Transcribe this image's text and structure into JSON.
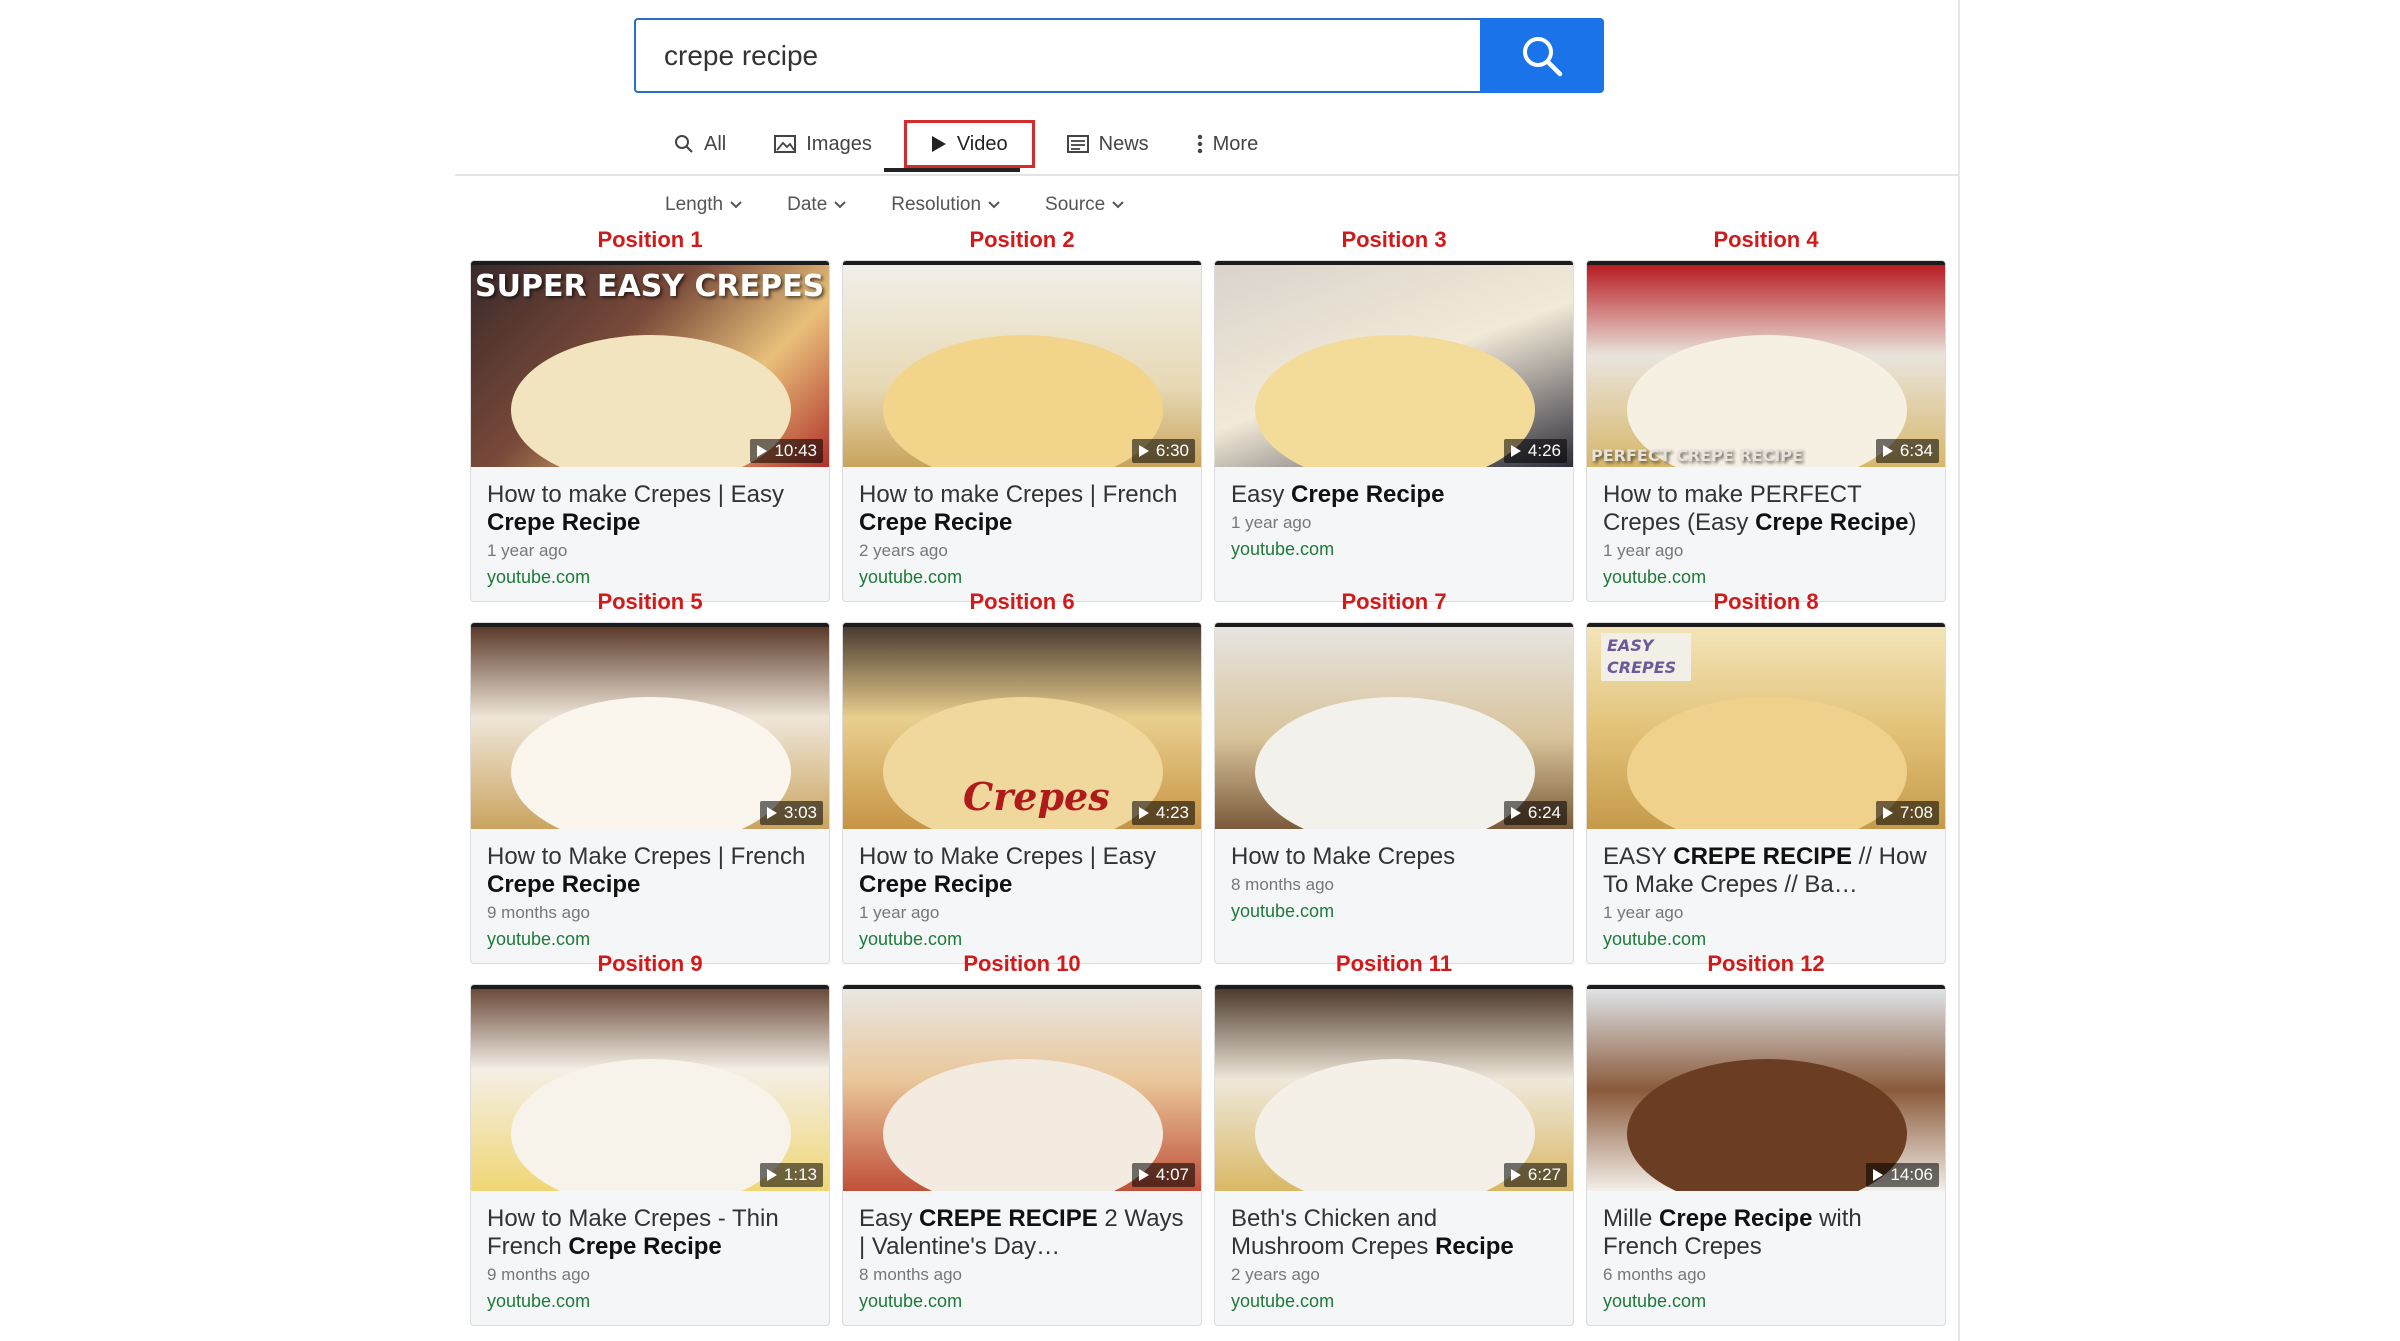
{
  "search": {
    "query": "crepe recipe"
  },
  "tabs": [
    {
      "label": "All",
      "icon": "search-icon"
    },
    {
      "label": "Images",
      "icon": "image-icon"
    },
    {
      "label": "Video",
      "icon": "play-icon",
      "active": true
    },
    {
      "label": "News",
      "icon": "news-icon"
    },
    {
      "label": "More",
      "icon": "more-vertical-icon"
    }
  ],
  "filters": [
    "Length",
    "Date",
    "Resolution",
    "Source"
  ],
  "colors": {
    "accent": "#1a73e8",
    "highlight_red": "#d11a1a",
    "source_green": "#1e7a3a"
  },
  "results": [
    {
      "position": "Position 1",
      "duration": "10:43",
      "title_parts": [
        [
          "How to make Crepes | Easy ",
          false
        ],
        [
          "Crepe Recipe",
          true
        ]
      ],
      "age": "1 year ago",
      "source": "youtube.com",
      "overlay": "SUPER EASY CREPES"
    },
    {
      "position": "Position 2",
      "duration": "6:30",
      "title_parts": [
        [
          "How to make Crepes | French ",
          false
        ],
        [
          "Crepe Recipe",
          true
        ]
      ],
      "age": "2 years ago",
      "source": "youtube.com"
    },
    {
      "position": "Position 3",
      "duration": "4:26",
      "title_parts": [
        [
          "Easy ",
          false
        ],
        [
          "Crepe Recipe",
          true
        ]
      ],
      "age": "1 year ago",
      "source": "youtube.com"
    },
    {
      "position": "Position 4",
      "duration": "6:34",
      "title_parts": [
        [
          "How to make PERFECT Crepes (Easy ",
          false
        ],
        [
          "Crepe Recipe",
          true
        ],
        [
          ")",
          false
        ]
      ],
      "age": "1 year ago",
      "source": "youtube.com",
      "overlay": "PERFECT CREPE RECIPE"
    },
    {
      "position": "Position 5",
      "duration": "3:03",
      "title_parts": [
        [
          "How to Make Crepes | French ",
          false
        ],
        [
          "Crepe Recipe",
          true
        ]
      ],
      "age": "9 months ago",
      "source": "youtube.com"
    },
    {
      "position": "Position 6",
      "duration": "4:23",
      "title_parts": [
        [
          "How to Make Crepes | Easy ",
          false
        ],
        [
          "Crepe Recipe",
          true
        ]
      ],
      "age": "1 year ago",
      "source": "youtube.com",
      "overlay": "Crepes"
    },
    {
      "position": "Position 7",
      "duration": "6:24",
      "title_parts": [
        [
          "How to Make Crepes",
          false
        ]
      ],
      "age": "8 months ago",
      "source": "youtube.com"
    },
    {
      "position": "Position 8",
      "duration": "7:08",
      "title_parts": [
        [
          "EASY ",
          false
        ],
        [
          "CREPE RECIPE",
          true
        ],
        [
          " // How To Make Crepes // Ba…",
          false
        ]
      ],
      "age": "1 year ago",
      "source": "youtube.com",
      "overlay": "EASY CREPES"
    },
    {
      "position": "Position 9",
      "duration": "1:13",
      "title_parts": [
        [
          "How to Make Crepes - Thin French ",
          false
        ],
        [
          "Crepe Recipe",
          true
        ]
      ],
      "age": "9 months ago",
      "source": "youtube.com"
    },
    {
      "position": "Position 10",
      "duration": "4:07",
      "title_parts": [
        [
          "Easy ",
          false
        ],
        [
          "CREPE RECIPE",
          true
        ],
        [
          " 2 Ways | Valentine's Day…",
          false
        ]
      ],
      "age": "8 months ago",
      "source": "youtube.com"
    },
    {
      "position": "Position 11",
      "duration": "6:27",
      "title_parts": [
        [
          "Beth's Chicken and Mushroom Crepes ",
          false
        ],
        [
          "Recipe",
          true
        ]
      ],
      "age": "2 years ago",
      "source": "youtube.com"
    },
    {
      "position": "Position 12",
      "duration": "14:06",
      "title_parts": [
        [
          "Mille ",
          false
        ],
        [
          "Crepe Recipe",
          true
        ],
        [
          " with French Crepes",
          false
        ]
      ],
      "age": "6 months ago",
      "source": "youtube.com"
    }
  ]
}
